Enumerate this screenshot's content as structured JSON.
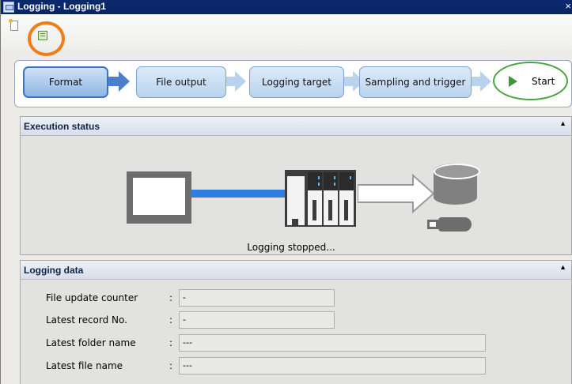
{
  "window": {
    "title": "Logging - Logging1",
    "close_glyph": "×"
  },
  "toolbar": {
    "icons": [
      "new-document-icon",
      "table-grid-icon"
    ],
    "highlight_color": "#ef7d1a"
  },
  "flow_steps": [
    {
      "label": "Format",
      "active": true
    },
    {
      "label": "File output",
      "active": false
    },
    {
      "label": "Logging target",
      "active": false
    },
    {
      "label": "Sampling and trigger",
      "active": false
    }
  ],
  "start_button": {
    "label": "Start",
    "color": "#3a9a34"
  },
  "execution_status": {
    "header": "Execution status",
    "status_text": "Logging stopped..."
  },
  "logging_data": {
    "header": "Logging data",
    "rows": [
      {
        "label": "File update counter",
        "colon": ":",
        "value": "-"
      },
      {
        "label": "Latest record No.",
        "colon": ":",
        "value": "-"
      },
      {
        "label": "Latest folder name",
        "colon": ":",
        "value": "---"
      },
      {
        "label": "Latest file name",
        "colon": ":",
        "value": "---"
      }
    ]
  },
  "colors": {
    "titlebar": "#0a2463",
    "active_step_border": "#3b74c2",
    "cable": "#2f7fe0"
  }
}
